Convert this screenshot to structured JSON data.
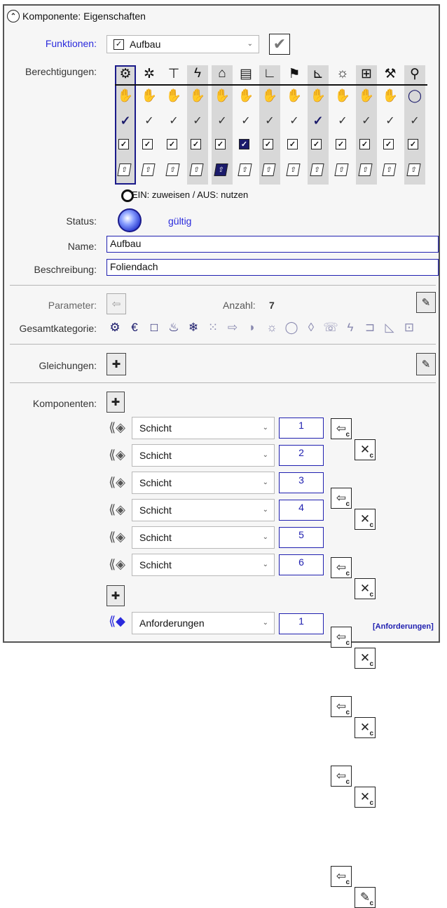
{
  "header": {
    "title": "Komponente: Eigenschaften",
    "collapse_icon": "chevron-up-icon"
  },
  "funktionen": {
    "label": "Funktionen:",
    "value": "Aufbau",
    "checked": true,
    "apply_icon": "checkmark-icon"
  },
  "berechtigungen": {
    "label": "Berechtigungen:",
    "columns": [
      {
        "icon": "structure-icon",
        "selected": true,
        "highlight": true
      },
      {
        "icon": "gear-icon",
        "selected": false,
        "highlight": false
      },
      {
        "icon": "faucet-icon",
        "selected": false,
        "highlight": false
      },
      {
        "icon": "electric-icon",
        "selected": false,
        "highlight": true
      },
      {
        "icon": "security-icon",
        "selected": false,
        "highlight": true
      },
      {
        "icon": "hvac-icon",
        "selected": false,
        "highlight": false
      },
      {
        "icon": "profile-icon",
        "selected": false,
        "highlight": true
      },
      {
        "icon": "fire-extinguisher-icon",
        "selected": false,
        "highlight": false
      },
      {
        "icon": "wall-icon",
        "selected": false,
        "highlight": true
      },
      {
        "icon": "lighting-icon",
        "selected": false,
        "highlight": false
      },
      {
        "icon": "network-icon",
        "selected": false,
        "highlight": true
      },
      {
        "icon": "tools-icon",
        "selected": false,
        "highlight": false
      },
      {
        "icon": "inspector-icon",
        "selected": false,
        "highlight": true
      }
    ],
    "row2_selected_columns": [
      0,
      8
    ],
    "row3_selected_columns": [
      5
    ],
    "row4_selected_columns": [
      4
    ],
    "legend": "EIN: zuweisen / AUS: nutzen"
  },
  "status": {
    "label": "Status:",
    "value": "gültig",
    "accent": "#2a2adc"
  },
  "name": {
    "label": "Name:",
    "value": "Aufbau"
  },
  "beschreibung": {
    "label": "Beschreibung:",
    "value": "Foliendach"
  },
  "parameter": {
    "label": "Parameter:",
    "anzahl_label": "Anzahl:",
    "anzahl_value": "7"
  },
  "gesamtkategorie": {
    "label": "Gesamtkategorie:",
    "icons": [
      "structure-icon",
      "heat-icon",
      "frame-icon",
      "fire-icon",
      "cold-icon",
      "dust-icon",
      "airflow-icon",
      "sound-icon",
      "light-icon",
      "bulb-icon",
      "water-icon",
      "phone-icon",
      "lightning-icon",
      "gateway-icon",
      "ruler-icon",
      "transport-icon"
    ]
  },
  "gleichungen": {
    "label": "Gleichungen:"
  },
  "komponenten": {
    "label": "Komponenten:",
    "rows": [
      {
        "type": "Schicht",
        "number": "1"
      },
      {
        "type": "Schicht",
        "number": "2"
      },
      {
        "type": "Schicht",
        "number": "3"
      },
      {
        "type": "Schicht",
        "number": "4"
      },
      {
        "type": "Schicht",
        "number": "5"
      },
      {
        "type": "Schicht",
        "number": "6"
      }
    ],
    "anforderung": {
      "type": "Anforderungen",
      "number": "1",
      "link": "[Anforderungen]"
    }
  }
}
